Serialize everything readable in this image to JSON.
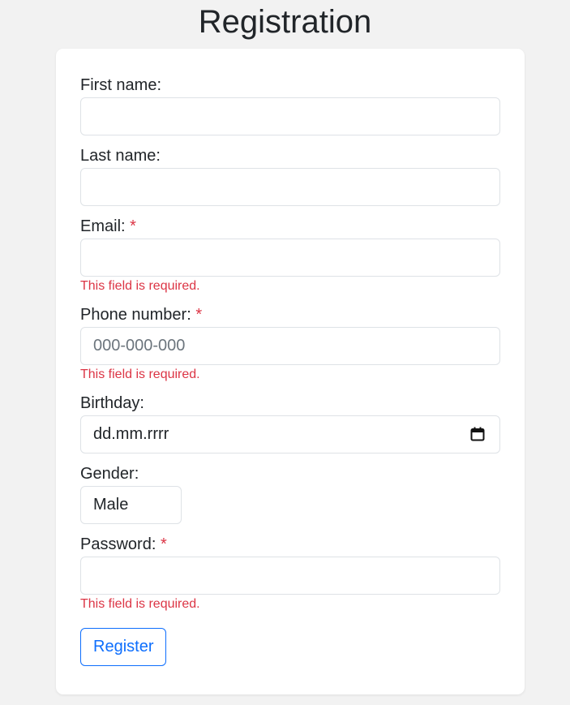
{
  "page": {
    "title": "Registration"
  },
  "form": {
    "first_name": {
      "label": "First name:",
      "value": "",
      "placeholder": ""
    },
    "last_name": {
      "label": "Last name:",
      "value": "",
      "placeholder": ""
    },
    "email": {
      "label": "Email:",
      "required_mark": "*",
      "value": "",
      "placeholder": "",
      "error": "This field is required."
    },
    "phone": {
      "label": "Phone number:",
      "required_mark": "*",
      "value": "",
      "placeholder": "000-000-000",
      "error": "This field is required."
    },
    "birthday": {
      "label": "Birthday:",
      "display": "dd.mm.rrrr",
      "icon": "calendar-icon"
    },
    "gender": {
      "label": "Gender:",
      "selected": "Male"
    },
    "password": {
      "label": "Password:",
      "required_mark": "*",
      "value": "",
      "placeholder": "",
      "error": "This field is required."
    },
    "submit_label": "Register"
  },
  "colors": {
    "background": "#f2f2f2",
    "card": "#ffffff",
    "error": "#dc3545",
    "accent": "#0d6efd",
    "border": "#dee2e6"
  }
}
